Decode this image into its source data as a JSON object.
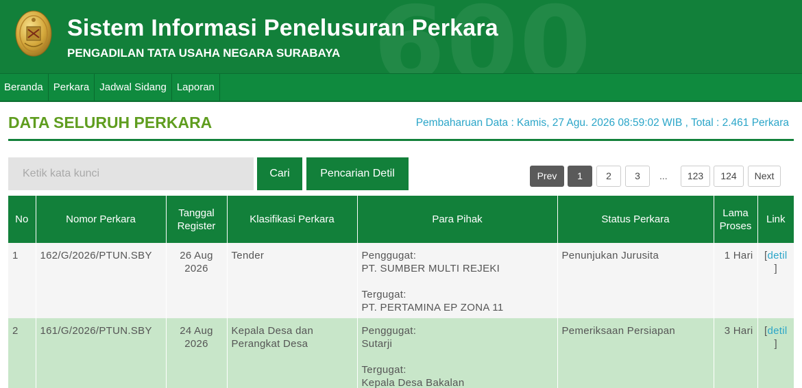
{
  "header": {
    "title": "Sistem Informasi Penelusuran Perkara",
    "subtitle": "PENGADILAN TATA USAHA NEGARA SURABAYA",
    "bg_digits": "600"
  },
  "nav": {
    "items": [
      "Beranda",
      "Perkara",
      "Jadwal Sidang",
      "Laporan"
    ]
  },
  "page": {
    "title": "DATA SELURUH PERKARA",
    "update_info": "Pembaharuan Data : Kamis, 27 Agu. 2026 08:59:02 WIB , Total : 2.461 Perkara"
  },
  "search": {
    "placeholder": "Ketik kata kunci",
    "cari_label": "Cari",
    "detil_label": "Pencarian Detil"
  },
  "pagination": {
    "prev": "Prev",
    "pages": [
      "1",
      "2",
      "3"
    ],
    "dots": "...",
    "last_pages": [
      "123",
      "124"
    ],
    "next": "Next",
    "current": "1"
  },
  "table": {
    "headers": [
      "No",
      "Nomor Perkara",
      "Tanggal Register",
      "Klasifikasi Perkara",
      "Para Pihak",
      "Status Perkara",
      "Lama Proses",
      "Link"
    ],
    "rows": [
      {
        "no": "1",
        "nomor": "162/G/2026/PTUN.SBY",
        "tanggal": "26 Aug 2026",
        "klasifikasi": "Tender",
        "penggugat_label": "Penggugat:",
        "penggugat": "PT. SUMBER MULTI REJEKI",
        "tergugat_label": "Tergugat:",
        "tergugat": "PT. PERTAMINA EP ZONA 11",
        "status": "Penunjukan Jurusita",
        "lama": "1 Hari",
        "link_open": "[",
        "link": "detil",
        "link_close": "]"
      },
      {
        "no": "2",
        "nomor": "161/G/2026/PTUN.SBY",
        "tanggal": "24 Aug 2026",
        "klasifikasi": "Kepala Desa dan Perangkat Desa",
        "penggugat_label": "Penggugat:",
        "penggugat": "Sutarji",
        "tergugat_label": "Tergugat:",
        "tergugat": "Kepala Desa Bakalan",
        "status": "Pemeriksaan Persiapan",
        "lama": "3 Hari",
        "link_open": "[",
        "link": "detil",
        "link_close": "]"
      }
    ]
  },
  "colors": {
    "primary_green": "#12803a",
    "title_green": "#5f9d1f",
    "info_blue": "#2aa5c8",
    "row_green": "#c8e6c9",
    "row_gray": "#f5f5f5"
  },
  "icons": {
    "logo": "court-emblem-icon"
  }
}
